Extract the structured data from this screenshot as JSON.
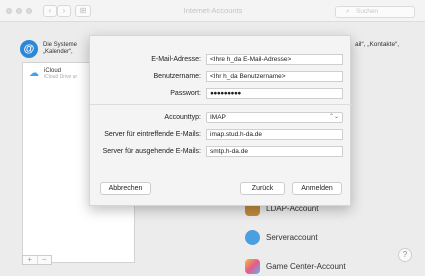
{
  "window": {
    "title": "Internet-Accounts",
    "search_placeholder": "Suchen"
  },
  "titlebar": {
    "back": "‹",
    "forward": "›",
    "grid": "⊞"
  },
  "top": {
    "line1": "Die Systeme",
    "line2": "„Kalender“,",
    "right_text": "ail“, „Kontakte“,"
  },
  "sidebar": {
    "items": [
      {
        "label": "iCloud",
        "sublabel": "iCloud Drive ur"
      }
    ],
    "add": "+",
    "remove": "−"
  },
  "list": {
    "items": [
      {
        "label": "LDAP-Account"
      },
      {
        "label": "Serveraccount"
      },
      {
        "label": "Game Center-Account"
      }
    ]
  },
  "form": {
    "email_label": "E-Mail-Adresse:",
    "email_value": "<Ihre h_da E-Mail-Adresse>",
    "user_label": "Benutzername:",
    "user_value": "<Ihr h_da Benutzername>",
    "password_label": "Passwort:",
    "password_value": "●●●●●●●●●",
    "type_label": "Accounttyp:",
    "type_value": "IMAP",
    "incoming_label": "Server für eintreffende E-Mails:",
    "incoming_value": "imap.stud.h-da.de",
    "outgoing_label": "Server für ausgehende E-Mails:",
    "outgoing_value": "smtp.h-da.de"
  },
  "buttons": {
    "cancel": "Abbrechen",
    "back": "Zurück",
    "signin": "Anmelden"
  },
  "help": "?"
}
